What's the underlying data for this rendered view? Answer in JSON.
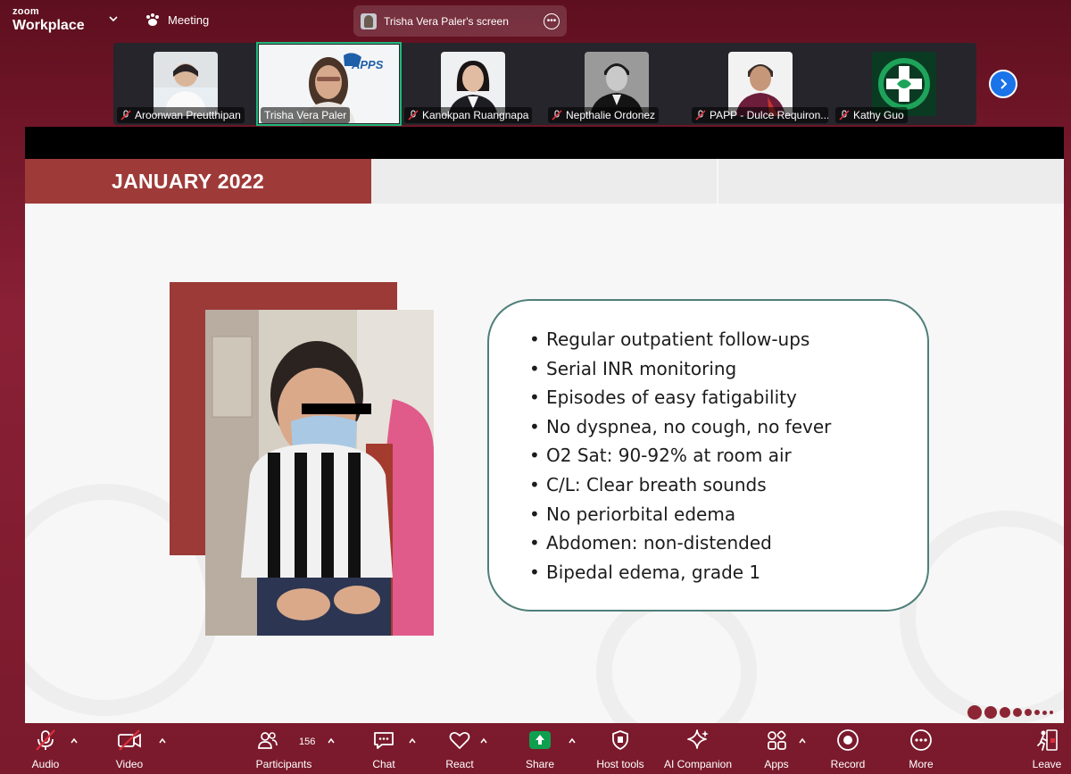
{
  "app": {
    "logo_top": "zoom",
    "logo_bottom": "Workplace",
    "meeting_label": "Meeting",
    "share_title": "Trisha Vera Paler's screen"
  },
  "gallery": {
    "participants": [
      {
        "name": "Aroonwan Preutthipan",
        "muted": true
      },
      {
        "name": "Trisha Vera Paler",
        "muted": false,
        "active_speaker": true
      },
      {
        "name": "Kanokpan Ruangnapa",
        "muted": true
      },
      {
        "name": "Nepthalie Ordonez",
        "muted": true
      },
      {
        "name": "PAPP - Dulce Requiron...",
        "muted": true
      },
      {
        "name": "Kathy Guo",
        "muted": true
      }
    ],
    "speaker_logo_text": "APPS"
  },
  "slide": {
    "heading": "JANUARY 2022",
    "bullets": [
      "Regular outpatient follow-ups",
      "Serial INR monitoring",
      "Episodes of easy fatigability",
      "No dyspnea, no cough, no fever",
      "O2 Sat: 90-92% at room air",
      "C/L: Clear breath sounds",
      "No periorbital edema",
      "Abdomen: non-distended",
      "Bipedal edema, grade 1"
    ],
    "accent_color": "#9e3b39",
    "box_border_color": "#4f7f79"
  },
  "toolbar": {
    "audio": "Audio",
    "video": "Video",
    "participants": "Participants",
    "participants_count": "156",
    "chat": "Chat",
    "react": "React",
    "share": "Share",
    "host_tools": "Host tools",
    "ai_companion": "AI Companion",
    "apps": "Apps",
    "record": "Record",
    "more": "More",
    "leave": "Leave",
    "share_color": "#0e9f4f",
    "leave_color": "#e02e3b"
  }
}
